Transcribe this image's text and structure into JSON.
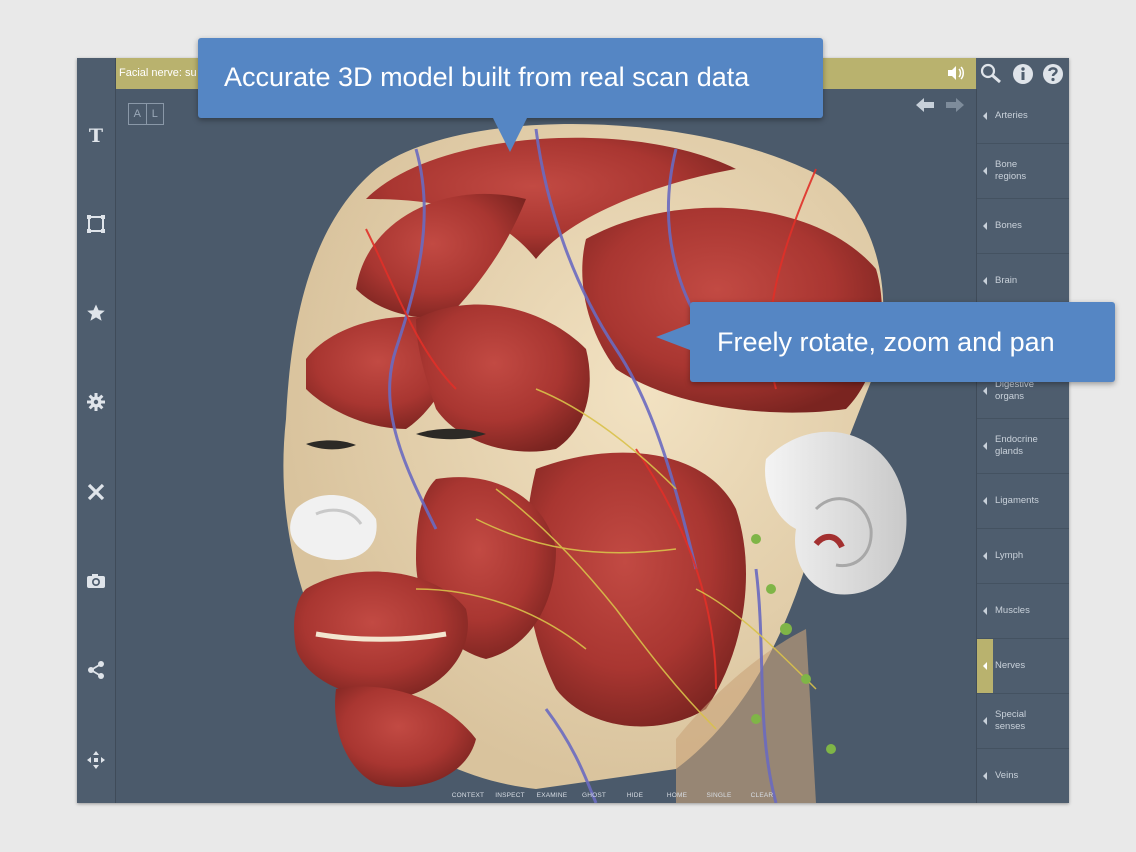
{
  "status_bar": {
    "text": "Facial nerve: su"
  },
  "badge": {
    "left": "A",
    "right": "L"
  },
  "callouts": {
    "top": "Accurate 3D model built from real scan data",
    "right": "Freely rotate, zoom and pan"
  },
  "categories": [
    {
      "label": "Arteries"
    },
    {
      "label": "Bone\nregions"
    },
    {
      "label": "Bones"
    },
    {
      "label": "Brain"
    },
    {
      "label": ""
    },
    {
      "label": "Digestive\norgans"
    },
    {
      "label": "Endocrine\nglands"
    },
    {
      "label": "Ligaments"
    },
    {
      "label": "Lymph"
    },
    {
      "label": "Muscles"
    },
    {
      "label": "Nerves",
      "active": true
    },
    {
      "label": "Special\nsenses"
    },
    {
      "label": "Veins"
    }
  ],
  "bottom_tools": [
    {
      "label": "CONTEXT",
      "icon": "context-icon"
    },
    {
      "label": "INSPECT",
      "icon": "inspect-icon"
    },
    {
      "label": "EXAMINE",
      "icon": "examine-icon"
    },
    {
      "label": "GHOST",
      "icon": "ghost-icon"
    },
    {
      "label": "HIDE",
      "icon": "hide-icon"
    },
    {
      "label": "HOME",
      "icon": "home-icon"
    },
    {
      "label": "SINGLE",
      "icon": "single-icon"
    },
    {
      "label": "CLEAR",
      "icon": "clear-icon"
    }
  ],
  "left_tools": [
    "text-icon",
    "frame-icon",
    "star-icon",
    "gear-icon",
    "tools-icon",
    "camera-icon",
    "share-icon",
    "move-icon"
  ],
  "colors": {
    "accent": "#b9b26e",
    "callout": "#5586c4",
    "panel": "#4e5d6e",
    "viewport": "#4b5a6b"
  }
}
